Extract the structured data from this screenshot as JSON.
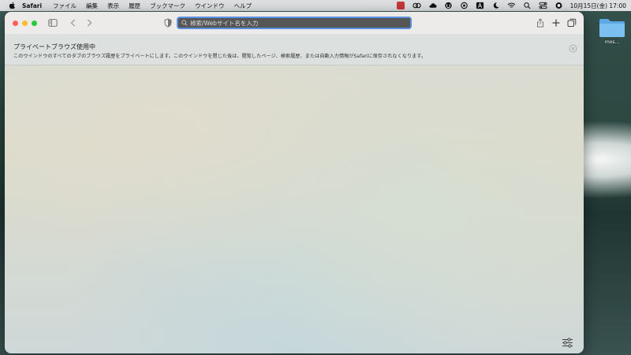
{
  "menubar": {
    "app_name": "Safari",
    "items": [
      "ファイル",
      "編集",
      "表示",
      "履歴",
      "ブックマーク",
      "ウインドウ",
      "ヘルプ"
    ],
    "clock": "10月15日(金)  17:00"
  },
  "desktop": {
    "folder_label": "mos..."
  },
  "toolbar": {
    "address_placeholder": "検索/Webサイト名を入力"
  },
  "banner": {
    "title": "プライベートブラウズ使用中",
    "text": "このウインドウのすべてのタブのブラウズ履歴をプライベートにします。このウインドウを閉じた後は、閲覧したページ、検索履歴、または自動入力情報がSafariに保存されなくなります。"
  },
  "colors": {
    "accent": "#5a8fdc",
    "close": "#fe5f57",
    "minimize": "#febc2e",
    "zoom": "#28c840"
  }
}
